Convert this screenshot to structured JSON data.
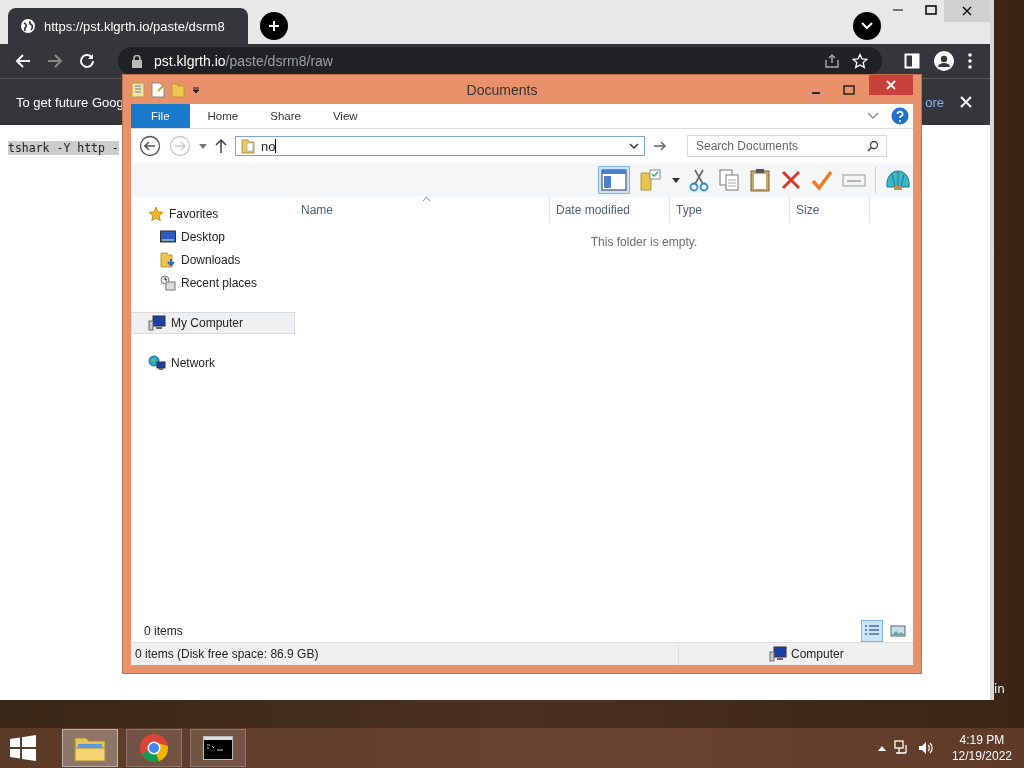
{
  "browser": {
    "tab_title": "https://pst.klgrth.io/paste/dsrm8",
    "url_host": "pst.klgrth.io",
    "url_path": "/paste/dsrm8/raw",
    "infobar_text": "To get future Goog",
    "infobar_link": "ore",
    "page_text": "tshark -Y http -"
  },
  "explorer": {
    "title": "Documents",
    "ribbon_tabs": [
      {
        "label": "File",
        "selected": true
      },
      {
        "label": "Home",
        "selected": false
      },
      {
        "label": "Share",
        "selected": false
      },
      {
        "label": "View",
        "selected": false
      }
    ],
    "address_value": "no",
    "search_placeholder": "Search Documents",
    "nav": [
      {
        "label": "Favorites",
        "kind": "favorites",
        "selected": false,
        "children": [
          {
            "label": "Desktop",
            "kind": "desktop",
            "selected": false
          },
          {
            "label": "Downloads",
            "kind": "downloads",
            "selected": false
          },
          {
            "label": "Recent places",
            "kind": "recent",
            "selected": false
          }
        ]
      },
      {
        "label": "My Computer",
        "kind": "computer",
        "selected": true
      },
      {
        "label": "Network",
        "kind": "network",
        "selected": false
      }
    ],
    "columns": [
      "Name",
      "Date modified",
      "Type",
      "Size"
    ],
    "empty_message": "This folder is empty.",
    "item_count": "0 items",
    "status_text": "0 items (Disk free space: 86.9 GB)",
    "status_location": "Computer"
  },
  "desktop_fragment": "in",
  "taskbar": {
    "apps": [
      {
        "kind": "explorer",
        "selected": true
      },
      {
        "kind": "chrome",
        "selected": false
      },
      {
        "kind": "console",
        "selected": false
      }
    ],
    "time": "4:19 PM",
    "date": "12/19/2022"
  }
}
